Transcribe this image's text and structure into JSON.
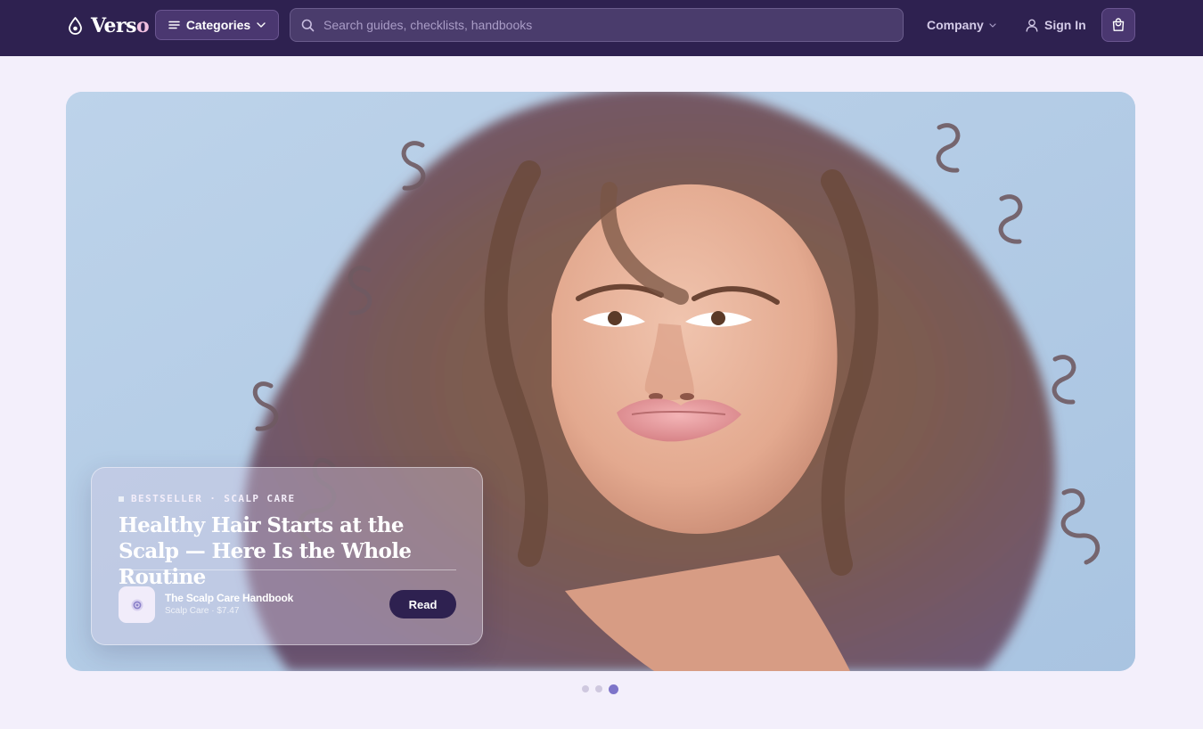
{
  "navbar": {
    "logo_main": "Vers",
    "logo_accent": "o",
    "categories_label": "Categories",
    "search_placeholder": "Search guides, checklists, handbooks",
    "company_label": "Company",
    "signin_label": "Sign In"
  },
  "hero": {
    "eyebrow": "BESTSELLER · SCALP CARE",
    "title": "Healthy Hair Starts at the Scalp — Here Is the Whole Routine",
    "product": {
      "name": "The Scalp Care Handbook",
      "meta": "Scalp Care · $7.47"
    },
    "read_label": "Read"
  },
  "carousel": {
    "total_slides": 3,
    "active_slide": 3
  },
  "colors": {
    "navbar_bg": "#2e2150",
    "page_bg": "#f3effb",
    "accent": "#7d74c9",
    "logo_accent": "#f0bfe0",
    "hero_sky": "#b6cde6"
  },
  "icons": [
    "water-drop-icon",
    "menu-icon",
    "chevron-down-icon",
    "search-icon",
    "user-icon",
    "shopping-bag-icon",
    "product-dot-icon"
  ]
}
